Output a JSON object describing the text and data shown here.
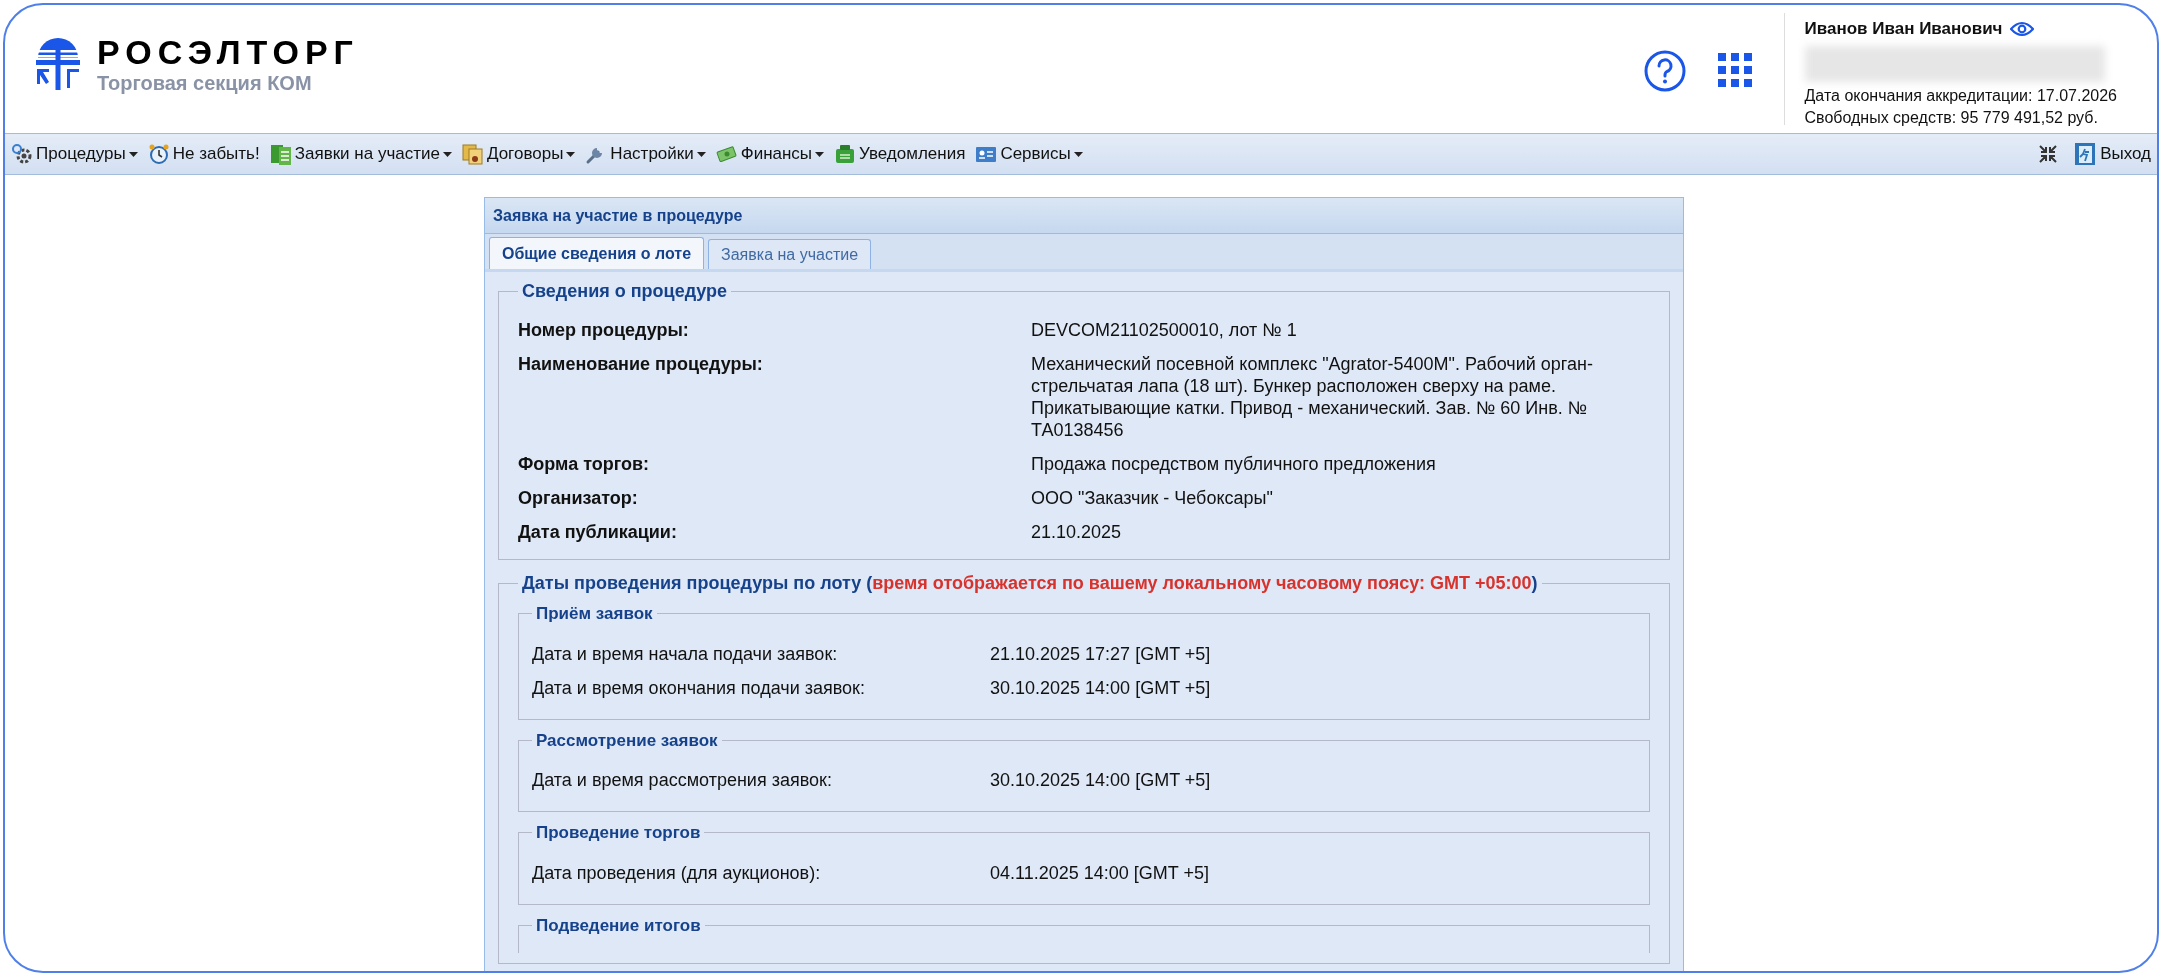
{
  "header": {
    "logo": {
      "name": "РОСЭЛТОРГ",
      "subtitle": "Торговая секция КОМ"
    },
    "user": {
      "name": "Иванов Иван Иванович",
      "accreditation": "Дата окончания аккредитации: 17.07.2026",
      "funds": "Свободных средств: 95 779 491,52 руб."
    }
  },
  "menu": {
    "items": [
      {
        "label": "Процедуры",
        "dropdown": true
      },
      {
        "label": "Не забыть!",
        "dropdown": false
      },
      {
        "label": "Заявки на участие",
        "dropdown": true
      },
      {
        "label": "Договоры",
        "dropdown": true
      },
      {
        "label": "Настройки",
        "dropdown": true
      },
      {
        "label": "Финансы",
        "dropdown": true
      },
      {
        "label": "Уведомления",
        "dropdown": false
      },
      {
        "label": "Сервисы",
        "dropdown": true
      }
    ],
    "exit": "Выход"
  },
  "panel": {
    "title": "Заявка на участие в процедуре",
    "tabs": [
      {
        "label": "Общие сведения о лоте",
        "selected": true
      },
      {
        "label": "Заявка на участие",
        "selected": false
      }
    ],
    "procedure": {
      "legend": "Сведения о процедуре",
      "rows": [
        {
          "label": "Номер процедуры:",
          "value": "DEVCOM21102500010, лот № 1"
        },
        {
          "label": "Наименование процедуры:",
          "value": "Механический посевной комплекс \"Agrator-5400M\". Рабочий орган-стрельчатая лапа (18 шт). Бункер расположен сверху на раме. Прикатывающие катки. Привод - механический. Зав. № 60 Инв. № ТА0138456"
        },
        {
          "label": "Форма торгов:",
          "value": "Продажа посредством публичного предложения"
        },
        {
          "label": "Организатор:",
          "value": "ООО \"Заказчик - Чебоксары\""
        },
        {
          "label": "Дата публикации:",
          "value": "21.10.2025"
        }
      ]
    },
    "dates": {
      "legend": "Даты проведения процедуры по лоту",
      "note_open": "(",
      "note": "время отображается по вашему локальному часовому поясу: GMT +05:00",
      "note_close": ")",
      "groups": [
        {
          "legend": "Приём заявок",
          "rows": [
            {
              "label": "Дата и время начала подачи заявок:",
              "value": "21.10.2025 17:27 [GMT +5]"
            },
            {
              "label": "Дата и время окончания подачи заявок:",
              "value": "30.10.2025 14:00 [GMT +5]"
            }
          ]
        },
        {
          "legend": "Рассмотрение заявок",
          "rows": [
            {
              "label": "Дата и время рассмотрения заявок:",
              "value": "30.10.2025 14:00 [GMT +5]"
            }
          ]
        },
        {
          "legend": "Проведение торгов",
          "rows": [
            {
              "label": "Дата проведения (для аукционов):",
              "value": "04.11.2025 14:00 [GMT +5]"
            }
          ]
        },
        {
          "legend": "Подведение итогов"
        }
      ]
    }
  }
}
